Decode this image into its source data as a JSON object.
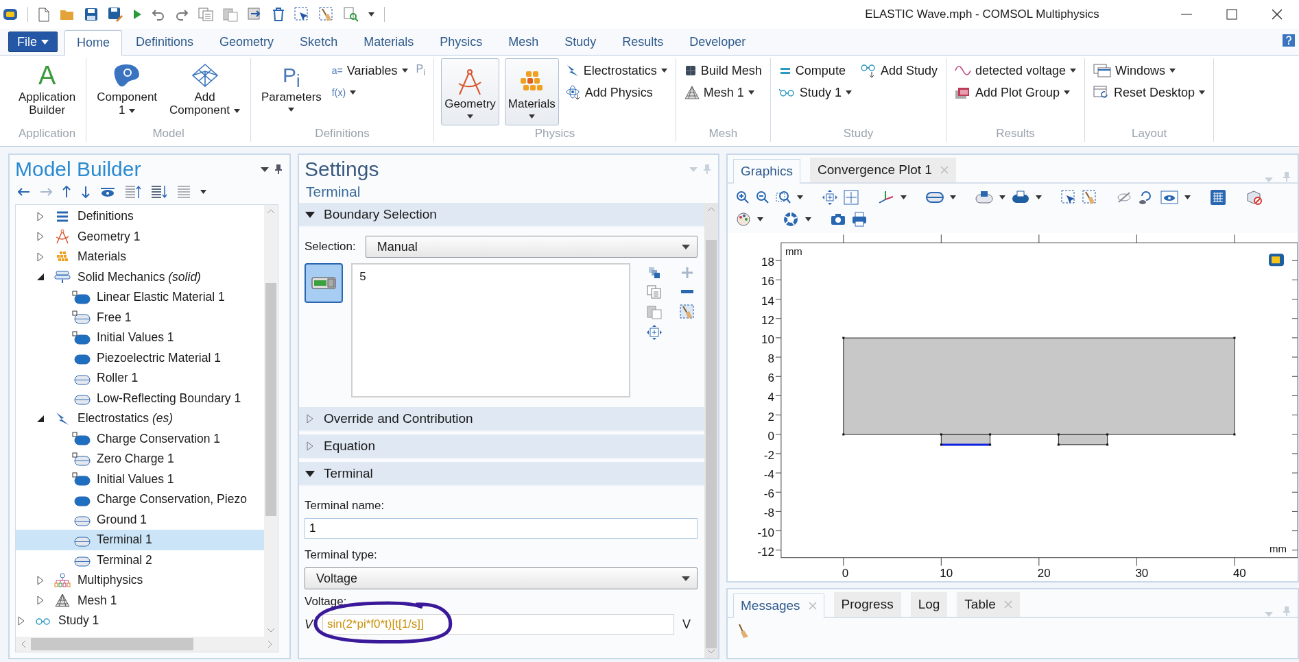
{
  "window": {
    "title": "ELASTIC Wave.mph - COMSOL Multiphysics"
  },
  "file_button": {
    "label": "File"
  },
  "ribbon_tabs": [
    {
      "label": "Home",
      "selected": true
    },
    {
      "label": "Definitions",
      "selected": false
    },
    {
      "label": "Geometry",
      "selected": false
    },
    {
      "label": "Sketch",
      "selected": false
    },
    {
      "label": "Materials",
      "selected": false
    },
    {
      "label": "Physics",
      "selected": false
    },
    {
      "label": "Mesh",
      "selected": false
    },
    {
      "label": "Study",
      "selected": false
    },
    {
      "label": "Results",
      "selected": false
    },
    {
      "label": "Developer",
      "selected": false
    }
  ],
  "ribbon_groups": [
    {
      "title": "Application",
      "large": [
        {
          "label": "Application\nBuilder",
          "icon_text": "A",
          "dropdown": false,
          "pressed": false
        }
      ]
    },
    {
      "title": "Model",
      "large": [
        {
          "label": "Component\n1",
          "dropdown": true,
          "pressed": false
        },
        {
          "label": "Add\nComponent",
          "dropdown": true,
          "pressed": false
        }
      ]
    },
    {
      "title": "Definitions",
      "large": [
        {
          "label": "Parameters",
          "icon_text": "P$_{i}$",
          "dropdown": true,
          "pressed": false
        }
      ],
      "small": [
        {
          "label": "Variables",
          "icon_text": "a=",
          "dropdown": true,
          "disabled": false
        },
        {
          "icon_text": "f(x)",
          "dropdown": true,
          "disabled": false
        },
        {
          "icon_text": "P$_{i}$",
          "dropdown": false,
          "disabled": true
        }
      ]
    },
    {
      "title": "Physics",
      "large": [
        {
          "label": "Geometry",
          "dropdown": true,
          "pressed": true
        },
        {
          "label": "Materials",
          "dropdown": true,
          "pressed": true
        }
      ],
      "small": [
        {
          "label": "Electrostatics",
          "dropdown": true,
          "disabled": false
        },
        {
          "label": "Add Physics",
          "dropdown": false,
          "disabled": false
        }
      ]
    },
    {
      "title": "Mesh",
      "small": [
        {
          "label": "Build Mesh",
          "dropdown": false,
          "disabled": false
        },
        {
          "label": "Mesh 1",
          "dropdown": true,
          "disabled": false
        }
      ]
    },
    {
      "title": "Study",
      "small": [
        {
          "label": "Compute",
          "dropdown": false,
          "disabled": false
        },
        {
          "label": "Study 1",
          "dropdown": true,
          "disabled": false
        },
        {
          "label": "Add Study",
          "dropdown": false,
          "disabled": false
        }
      ]
    },
    {
      "title": "Results",
      "small": [
        {
          "label": "detected voltage",
          "dropdown": true,
          "disabled": false
        },
        {
          "label": "Add Plot Group",
          "dropdown": true,
          "disabled": false
        }
      ]
    },
    {
      "title": "Layout",
      "small": [
        {
          "label": "Windows",
          "dropdown": true,
          "disabled": false
        },
        {
          "label": "Reset Desktop",
          "dropdown": true,
          "disabled": false
        }
      ]
    }
  ],
  "model_builder": {
    "title": "Model Builder",
    "tree_component_children": [
      {
        "label": "Definitions",
        "kind": "definitions",
        "expanded": false,
        "selected": false
      },
      {
        "label": "Geometry 1",
        "kind": "geometry",
        "expanded": false,
        "selected": false
      },
      {
        "label": "Materials",
        "kind": "materials",
        "expanded": false,
        "selected": false
      },
      {
        "label": "Solid Mechanics *(solid)*",
        "kind": "physics-solid",
        "expanded": true,
        "selected": false,
        "children": [
          {
            "label": "Linear Elastic Material 1",
            "kind": "domain-default",
            "selected": false
          },
          {
            "label": "Free 1",
            "kind": "boundary-default",
            "selected": false
          },
          {
            "label": "Initial Values 1",
            "kind": "domain-default",
            "selected": false
          },
          {
            "label": "Piezoelectric Material 1",
            "kind": "domain",
            "selected": false
          },
          {
            "label": "Roller 1",
            "kind": "boundary",
            "selected": false
          },
          {
            "label": "Low-Reflecting Boundary 1",
            "kind": "boundary",
            "selected": false
          }
        ]
      },
      {
        "label": "Electrostatics *(es)*",
        "kind": "physics-es",
        "expanded": true,
        "selected": false,
        "children": [
          {
            "label": "Charge Conservation 1",
            "kind": "domain-default",
            "selected": false
          },
          {
            "label": "Zero Charge 1",
            "kind": "boundary-default",
            "selected": false
          },
          {
            "label": "Initial Values 1",
            "kind": "domain-default",
            "selected": false
          },
          {
            "label": "Charge Conservation, Piezo",
            "kind": "domain",
            "selected": false
          },
          {
            "label": "Ground 1",
            "kind": "boundary",
            "selected": false
          },
          {
            "label": "Terminal 1",
            "kind": "boundary",
            "selected": true
          },
          {
            "label": "Terminal 2",
            "kind": "boundary",
            "selected": false
          }
        ]
      },
      {
        "label": "Multiphysics",
        "kind": "multiphysics",
        "expanded": false,
        "selected": false
      },
      {
        "label": "Mesh 1",
        "kind": "mesh",
        "expanded": false,
        "selected": false
      }
    ],
    "tree_root_items": [
      {
        "label": "Study 1",
        "kind": "study",
        "expanded": false,
        "selected": false
      }
    ]
  },
  "settings": {
    "title": "Settings",
    "subtitle": "Terminal",
    "sections": [
      {
        "kind": "selection",
        "title": "Boundary Selection",
        "expanded": true,
        "selection_label": "Selection:",
        "selection_value": "Manual",
        "toggle_active": true,
        "entities": [
          "5"
        ]
      },
      {
        "kind": "plain",
        "title": "Override and Contribution",
        "expanded": false
      },
      {
        "kind": "plain",
        "title": "Equation",
        "expanded": false
      },
      {
        "kind": "terminal",
        "title": "Terminal",
        "expanded": true,
        "name_label": "Terminal name:",
        "name_value": "1",
        "type_label": "Terminal type:",
        "type_value": "Voltage",
        "voltage_label": "Voltage:",
        "voltage_symbol": "V",
        "voltage_value": "sin(2*pi*f0*t)[t[1/s]]",
        "voltage_unit": "V"
      }
    ]
  },
  "graphics": {
    "tabs": [
      {
        "label": "Graphics",
        "selected": true,
        "closable": false
      },
      {
        "label": "Convergence Plot 1",
        "selected": false,
        "closable": true
      }
    ],
    "plot": {
      "y_unit": "mm",
      "x_unit": "mm",
      "y_ticks": [
        "18",
        "16",
        "14",
        "12",
        "10",
        "8",
        "6",
        "4",
        "2",
        "0",
        "-2",
        "-4",
        "-6",
        "-8",
        "-10",
        "-12"
      ],
      "x_ticks": [
        "0",
        "10",
        "20",
        "30",
        "40"
      ]
    }
  },
  "messages": {
    "tabs": [
      {
        "label": "Messages",
        "selected": true,
        "closable": true
      },
      {
        "label": "Progress",
        "selected": false,
        "closable": false
      },
      {
        "label": "Log",
        "selected": false,
        "closable": false
      },
      {
        "label": "Table",
        "selected": false,
        "closable": true
      }
    ]
  }
}
